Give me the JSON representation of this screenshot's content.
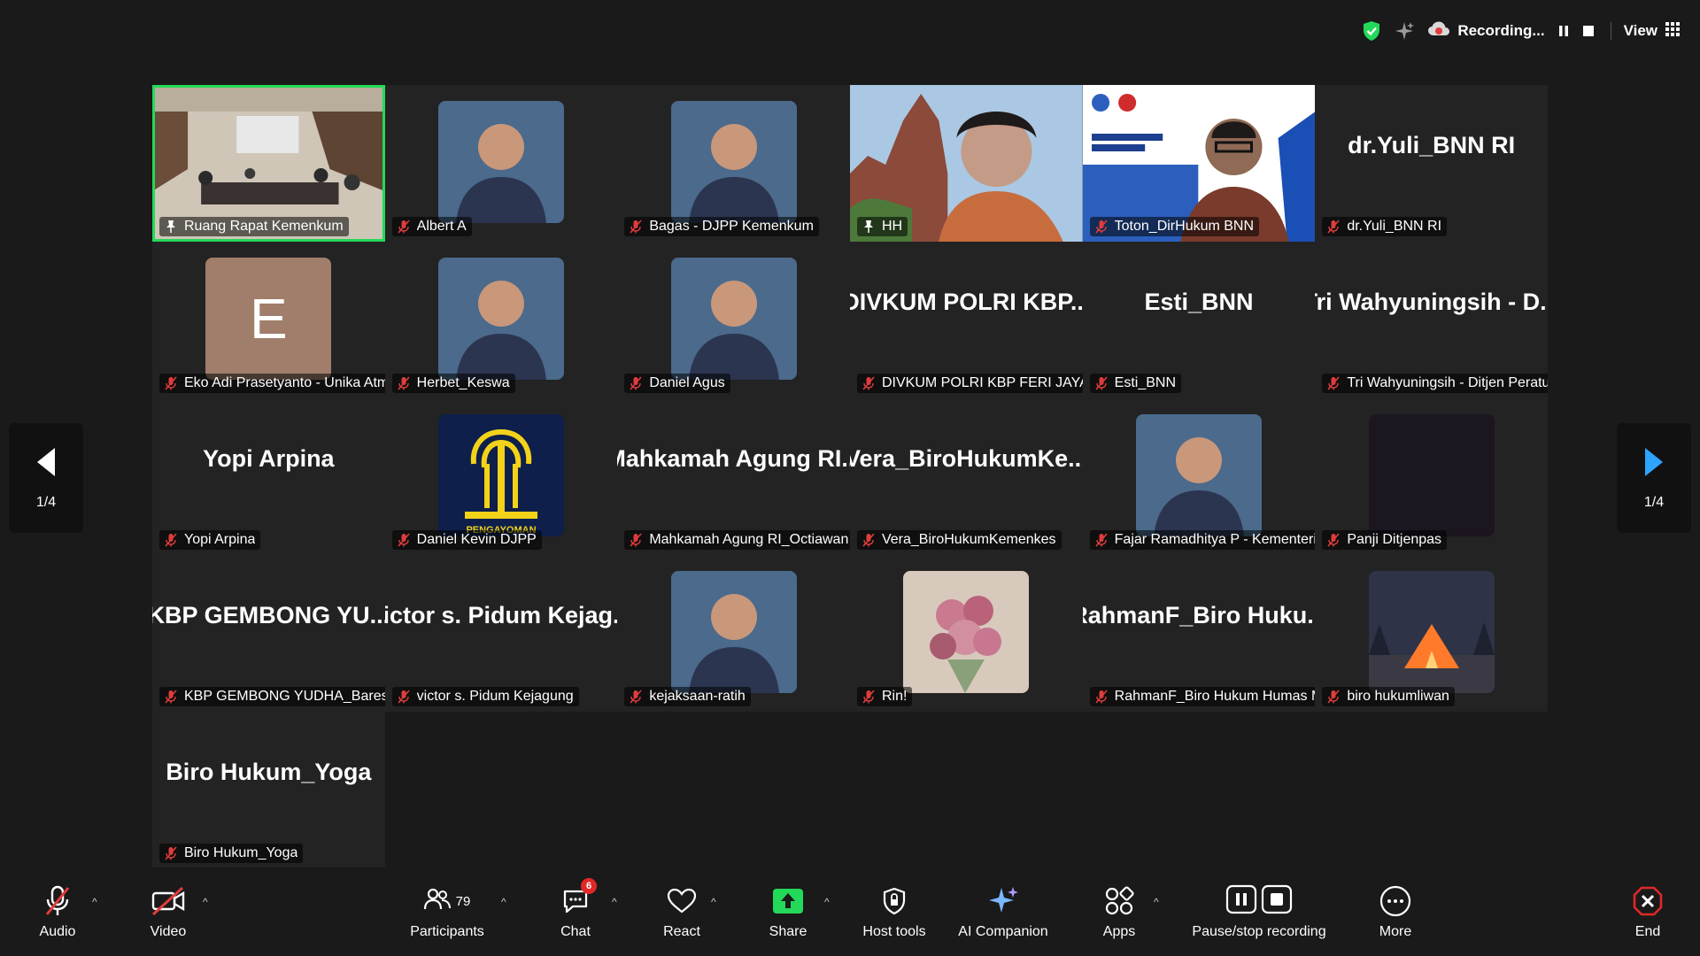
{
  "topbar": {
    "recording_text": "Recording...",
    "view_label": "View"
  },
  "pager": {
    "left_count": "1/4",
    "right_count": "1/4"
  },
  "tiles": [
    {
      "name": "Ruang Rapat Kemenkum",
      "kind": "video-room",
      "active": true,
      "muted": false
    },
    {
      "name": "Albert A",
      "kind": "photo",
      "muted": true
    },
    {
      "name": "Bagas - DJPP Kemenkum",
      "kind": "photo",
      "muted": true
    },
    {
      "name": "HH",
      "kind": "video-full",
      "muted": false
    },
    {
      "name": "Toton_DirHukum BNN",
      "kind": "video-full",
      "muted": true
    },
    {
      "name": "dr.Yuli_BNN RI",
      "big": "dr.Yuli_BNN RI",
      "kind": "text",
      "muted": true
    },
    {
      "name": "Eko Adi Prasetyanto - Unika Atm...",
      "kind": "letter",
      "letter": "E",
      "muted": true
    },
    {
      "name": "Herbet_Keswa",
      "kind": "photo",
      "muted": true
    },
    {
      "name": "Daniel Agus",
      "kind": "photo",
      "muted": true
    },
    {
      "name": "DIVKUM POLRI KBP FERI JAYA",
      "big": "DIVKUM POLRI KBP...",
      "kind": "text",
      "muted": true
    },
    {
      "name": "Esti_BNN",
      "big": "Esti_BNN",
      "kind": "text",
      "muted": true
    },
    {
      "name": "Tri Wahyuningsih - Ditjen Peratur...",
      "big": "Tri Wahyuningsih - D...",
      "kind": "text",
      "muted": true
    },
    {
      "name": "Yopi Arpina",
      "big": "Yopi Arpina",
      "kind": "text",
      "muted": true
    },
    {
      "name": "Daniel Kevin DJPP",
      "kind": "logo",
      "logo_text": "PENGAYOMAN",
      "muted": true
    },
    {
      "name": "Mahkamah Agung RI_Octiawan B...",
      "big": "Mahkamah Agung RI...",
      "kind": "text",
      "muted": true
    },
    {
      "name": "Vera_BiroHukumKemenkes",
      "big": "Vera_BiroHukumKe...",
      "kind": "text",
      "muted": true
    },
    {
      "name": "Fajar Ramadhitya P - Kementeria...",
      "kind": "photo",
      "muted": true
    },
    {
      "name": "Panji Ditjenpas",
      "kind": "dark",
      "muted": true
    },
    {
      "name": "KBP GEMBONG YUDHA_Bareskr...",
      "big": "KBP GEMBONG YU...",
      "kind": "text",
      "muted": true
    },
    {
      "name": "victor s. Pidum Kejagung",
      "big": "victor s. Pidum Kejag...",
      "kind": "text",
      "muted": true
    },
    {
      "name": "kejaksaan-ratih",
      "kind": "photo",
      "muted": true
    },
    {
      "name": "Rin!",
      "kind": "photo-flower",
      "muted": true
    },
    {
      "name": "RahmanF_Biro Hukum Humas M...",
      "big": "RahmanF_Biro Huku...",
      "kind": "text",
      "muted": true
    },
    {
      "name": "biro hukumliwan",
      "kind": "photo-tent",
      "muted": true
    },
    {
      "name": "Biro Hukum_Yoga",
      "big": "Biro Hukum_Yoga",
      "kind": "text",
      "muted": true
    }
  ],
  "toolbar": {
    "audio": "Audio",
    "video": "Video",
    "participants": "Participants",
    "participants_count": "79",
    "chat": "Chat",
    "chat_badge": "6",
    "react": "React",
    "share": "Share",
    "host_tools": "Host tools",
    "ai_companion": "AI Companion",
    "apps": "Apps",
    "pause_stop": "Pause/stop recording",
    "more": "More",
    "end": "End"
  },
  "colors": {
    "active_border": "#23d959",
    "mute_red": "#e03c3c",
    "share_green": "#23d959",
    "end_red": "#e02828"
  }
}
